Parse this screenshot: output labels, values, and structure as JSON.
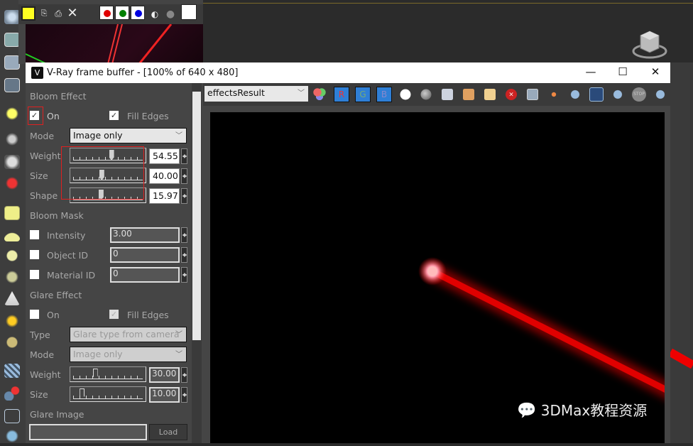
{
  "background_window": {
    "toolbar": {
      "icons": [
        "save-icon",
        "copy-icon",
        "print-icon",
        "clear-icon"
      ],
      "channels": [
        "#e00000",
        "#008000",
        "#0000e0"
      ]
    }
  },
  "vfb": {
    "title": "V-Ray frame buffer - [100% of 640 x 480]",
    "window_buttons": {
      "minimize": "—",
      "maximize": "☐",
      "close": "✕"
    },
    "toolbar": {
      "channel_select": "effectsResult",
      "r": "R",
      "g": "G",
      "b": "B"
    },
    "bloom": {
      "header": "Bloom Effect",
      "on_label": "On",
      "on_checked": true,
      "fill_edges_label": "Fill Edges",
      "fill_edges_checked": true,
      "mode_label": "Mode",
      "mode_value": "Image only",
      "weight_label": "Weight",
      "weight_value": "54.55",
      "weight_pos": 0.55,
      "size_label": "Size",
      "size_value": "40.00",
      "size_pos": 0.4,
      "shape_label": "Shape",
      "shape_value": "15.97",
      "shape_pos": 0.39
    },
    "bloom_mask": {
      "header": "Bloom Mask",
      "intensity_label": "Intensity",
      "intensity_value": "3.00",
      "object_id_label": "Object ID",
      "object_id_value": "0",
      "material_id_label": "Material ID",
      "material_id_value": "0"
    },
    "glare": {
      "header": "Glare Effect",
      "on_label": "On",
      "on_checked": false,
      "fill_edges_label": "Fill Edges",
      "fill_edges_checked": true,
      "type_label": "Type",
      "type_value": "Glare type from camera",
      "mode_label": "Mode",
      "mode_value": "Image only",
      "weight_label": "Weight",
      "weight_value": "30.00",
      "weight_pos": 0.3,
      "size_label": "Size",
      "size_value": "10.00",
      "size_pos": 0.1
    },
    "glare_image": {
      "header": "Glare Image",
      "load": "Load"
    }
  },
  "watermark": "3DMax教程资源",
  "colors": {
    "beam": "#e00000",
    "highlight": "#e02020",
    "panel": "#454545"
  }
}
